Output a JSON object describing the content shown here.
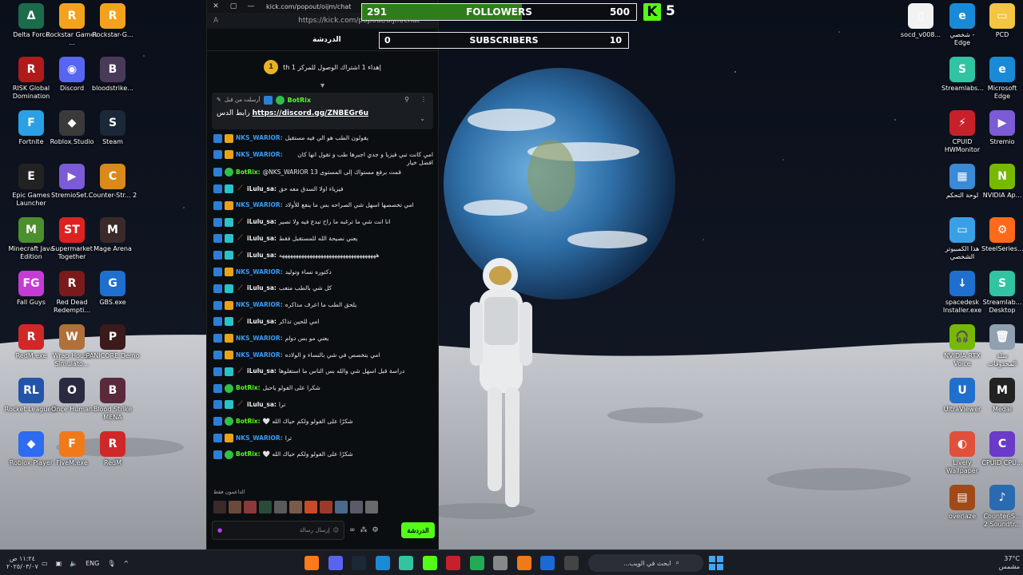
{
  "window": {
    "url_short": "kick.com/popout/oijm/chat",
    "url_full": "https://kick.com/popout/oijm/chat",
    "tab_label": "الدردشة"
  },
  "goal": {
    "coin_value": "1",
    "text": "إهداء 1 اشتراك الوصول للمركز 1 th"
  },
  "pinned": {
    "meta": "أرسلت من قبل",
    "bot_name": "BotRix",
    "link_prefix": "رابط الدس",
    "link": "https://discord.gg/ZNBEGr6u"
  },
  "messages": [
    {
      "user": "NKS_WARIOR",
      "kind": "nks",
      "text": "يقولون الطب هو الي فيه مستقبل"
    },
    {
      "user": "NKS_WARIOR",
      "kind": "nks",
      "text": "امي كانت تبي فيزيا و جدي اجبرها طب و تقول انها كان افضل خيار"
    },
    {
      "user": "BotRix",
      "kind": "bot",
      "text": "@NKS_WARIOR 13 قمت برفع مستواك إلى المستوى"
    },
    {
      "user": "iLulu_sa",
      "kind": "lulu",
      "text": "فيزياء اولا السدق معه حق"
    },
    {
      "user": "NKS_WARIOR",
      "kind": "nks",
      "text": "امي تخصصها اسهل شي الصراحه بس ما ينفع للأولاد"
    },
    {
      "user": "iLulu_sa",
      "kind": "lulu",
      "text": "انا انت شي ما ترغبه ما راح تبدع فيه ولا تصير"
    },
    {
      "user": "iLulu_sa",
      "kind": "lulu",
      "text": "يعني نصيحة الله للمستقبل فقط"
    },
    {
      "user": "iLulu_sa",
      "kind": "lulu",
      "text": "هههههههههههههههههههههههههههههههههههه"
    },
    {
      "user": "NKS_WARIOR",
      "kind": "nks",
      "text": "دكتوره نساء وتوليد"
    },
    {
      "user": "iLulu_sa",
      "kind": "lulu",
      "text": "كل شي بالطب متعب"
    },
    {
      "user": "NKS_WARIOR",
      "kind": "nks",
      "text": "يلحق الطب ما اعرف مذاكره"
    },
    {
      "user": "iLulu_sa",
      "kind": "lulu",
      "text": "امي للحين تذاكر"
    },
    {
      "user": "NKS_WARIOR",
      "kind": "nks",
      "text": "يعني مو بس دوام"
    },
    {
      "user": "NKS_WARIOR",
      "kind": "nks",
      "text": "امي بتخصص في شي بالنساء و الولاده"
    },
    {
      "user": "iLulu_sa",
      "kind": "lulu",
      "text": "دراسة قبل اسهل شي والله بس الناس ما استغلوها"
    },
    {
      "user": "BotRix",
      "kind": "bot",
      "text": "شكرا على الفولو ياحبل"
    },
    {
      "user": "iLulu_sa",
      "kind": "lulu",
      "text": "ترا"
    },
    {
      "user": "BotRix",
      "kind": "bot",
      "text": "شكرًا على الفولو ولكم حياك الله 🤍"
    },
    {
      "user": "NKS_WARIOR",
      "kind": "nks",
      "text": "ترا"
    },
    {
      "user": "BotRix",
      "kind": "bot",
      "text": "شكرًا على الفولو ولكم حياك الله 🤍"
    }
  ],
  "footer": {
    "supporters_label": "الداعمون فقط",
    "input_placeholder": "إرسال رسالة",
    "send_label": "الدردشة"
  },
  "followers": {
    "current": "291",
    "label": "FOLLOWERS",
    "goal": "500",
    "progress": 0.582
  },
  "subscribers": {
    "current": "0",
    "label": "SUBSCRIBERS",
    "goal": "10",
    "progress": 0
  },
  "kick_count": "5",
  "desktop_left": [
    {
      "label": "Delta Force",
      "glyph": "Δ",
      "color": "#1c6b4b"
    },
    {
      "label": "Rockstar Games ...",
      "glyph": "R",
      "color": "#f4a21d"
    },
    {
      "label": "Rockstar-G...",
      "glyph": "R",
      "color": "#f4a21d"
    },
    {
      "label": "RISK Global Domination",
      "glyph": "R",
      "color": "#b01a1a"
    },
    {
      "label": "Discord",
      "glyph": "◉",
      "color": "#5865f2"
    },
    {
      "label": "bloodstrike...",
      "glyph": "B",
      "color": "#4a3a5a"
    },
    {
      "label": "Fortnite",
      "glyph": "F",
      "color": "#2aa0e6"
    },
    {
      "label": "Roblox Studio",
      "glyph": "◆",
      "color": "#3a3a3a"
    },
    {
      "label": "Steam",
      "glyph": "S",
      "color": "#1b2838"
    },
    {
      "label": "Epic Games Launcher",
      "glyph": "E",
      "color": "#222"
    },
    {
      "label": "StremioSet...",
      "glyph": "▶",
      "color": "#7b5bd6"
    },
    {
      "label": "Counter-Str... 2",
      "glyph": "C",
      "color": "#d98a1a"
    },
    {
      "label": "Minecraft Java Edition",
      "glyph": "M",
      "color": "#4c8f2f"
    },
    {
      "label": "Supermarket Together",
      "glyph": "ST",
      "color": "#d22"
    },
    {
      "label": "Mage Arena",
      "glyph": "M",
      "color": "#3a2a2a"
    },
    {
      "label": "Fall Guys",
      "glyph": "FG",
      "color": "#c43bd6"
    },
    {
      "label": "Red Dead Redempti...",
      "glyph": "R",
      "color": "#7a1a1a"
    },
    {
      "label": "GBS.exe",
      "glyph": "G",
      "color": "#1f6fcf"
    },
    {
      "label": "RedM.exe",
      "glyph": "R",
      "color": "#d02828"
    },
    {
      "label": "Wrap House Simulato...",
      "glyph": "W",
      "color": "#b0703a"
    },
    {
      "label": "PANICORE Demo",
      "glyph": "P",
      "color": "#3a1a1a"
    },
    {
      "label": "Rocket League®",
      "glyph": "RL",
      "color": "#2255aa"
    },
    {
      "label": "Once Human",
      "glyph": "O",
      "color": "#2a2a40"
    },
    {
      "label": "Blood Strike MENA",
      "glyph": "B",
      "color": "#5a2a3a"
    },
    {
      "label": "Roblox Player",
      "glyph": "◆",
      "color": "#2d6bf0"
    },
    {
      "label": "FiveM.exe",
      "glyph": "F",
      "color": "#f07a1a"
    },
    {
      "label": "RedM",
      "glyph": "R",
      "color": "#d02828"
    }
  ],
  "desktop_right": [
    {
      "label": "socd_v008...",
      "glyph": "▯",
      "color": "#f2f2f2"
    },
    {
      "label": "شخصي - Edge",
      "glyph": "e",
      "color": "#1a8ad6"
    },
    {
      "label": "PCD",
      "glyph": "▭",
      "color": "#f4c542"
    },
    {
      "label": "Streamlabs...",
      "glyph": "S",
      "color": "#31c3a2"
    },
    {
      "label": "Microsoft Edge",
      "glyph": "e",
      "color": "#1a8ad6"
    },
    {
      "label": "CPUID HWMonitor",
      "glyph": "⚡",
      "color": "#c8202a"
    },
    {
      "label": "Stremio",
      "glyph": "▶",
      "color": "#7b5bd6"
    },
    {
      "label": "لوحة التحكم",
      "glyph": "▦",
      "color": "#3a8ad6"
    },
    {
      "label": "NVIDIA Ap...",
      "glyph": "N",
      "color": "#76b900"
    },
    {
      "label": "هذا الكمبيوتر الشخصي",
      "glyph": "▭",
      "color": "#3aa0e6"
    },
    {
      "label": "SteelSeries...",
      "glyph": "⚙",
      "color": "#ff6a1a"
    },
    {
      "label": "spacedesk Installer.exe",
      "glyph": "↓",
      "color": "#1f6fcf"
    },
    {
      "label": "Streamlab... Desktop",
      "glyph": "S",
      "color": "#31c3a2"
    },
    {
      "label": "NVIDIA RTX Voice",
      "glyph": "🎧",
      "color": "#76b900"
    },
    {
      "label": "سلة المحذوفات",
      "glyph": "🗑",
      "color": "#8fa0b0"
    },
    {
      "label": "UltraViewer",
      "glyph": "U",
      "color": "#1f6fcf"
    },
    {
      "label": "Medal",
      "glyph": "M",
      "color": "#222"
    },
    {
      "label": "Lively Wallpaper",
      "glyph": "◐",
      "color": "#e0503a"
    },
    {
      "label": "CPUID CPU...",
      "glyph": "C",
      "color": "#6a3ac8"
    },
    {
      "label": "overlaze",
      "glyph": "▤",
      "color": "#a04a1a"
    },
    {
      "label": "Counter-S... 2 Soundtr...",
      "glyph": "♪",
      "color": "#2a6ab0"
    }
  ],
  "taskbar": {
    "time": "١١:٢٤ ص",
    "date": "٢٠٢٥/٠٣/٠٧",
    "lang": "ENG",
    "search_placeholder": "ابحث في الويب...",
    "weather_temp": "37°C",
    "weather_text": "مشمس",
    "apps": [
      "#ff7a1a",
      "#5865f2",
      "#1b2838",
      "#1a8ad6",
      "#31c3a2",
      "#53fc18",
      "#c8202a",
      "#22aa55",
      "#888",
      "#f07a1a",
      "#1a6ad6",
      "#444"
    ]
  }
}
